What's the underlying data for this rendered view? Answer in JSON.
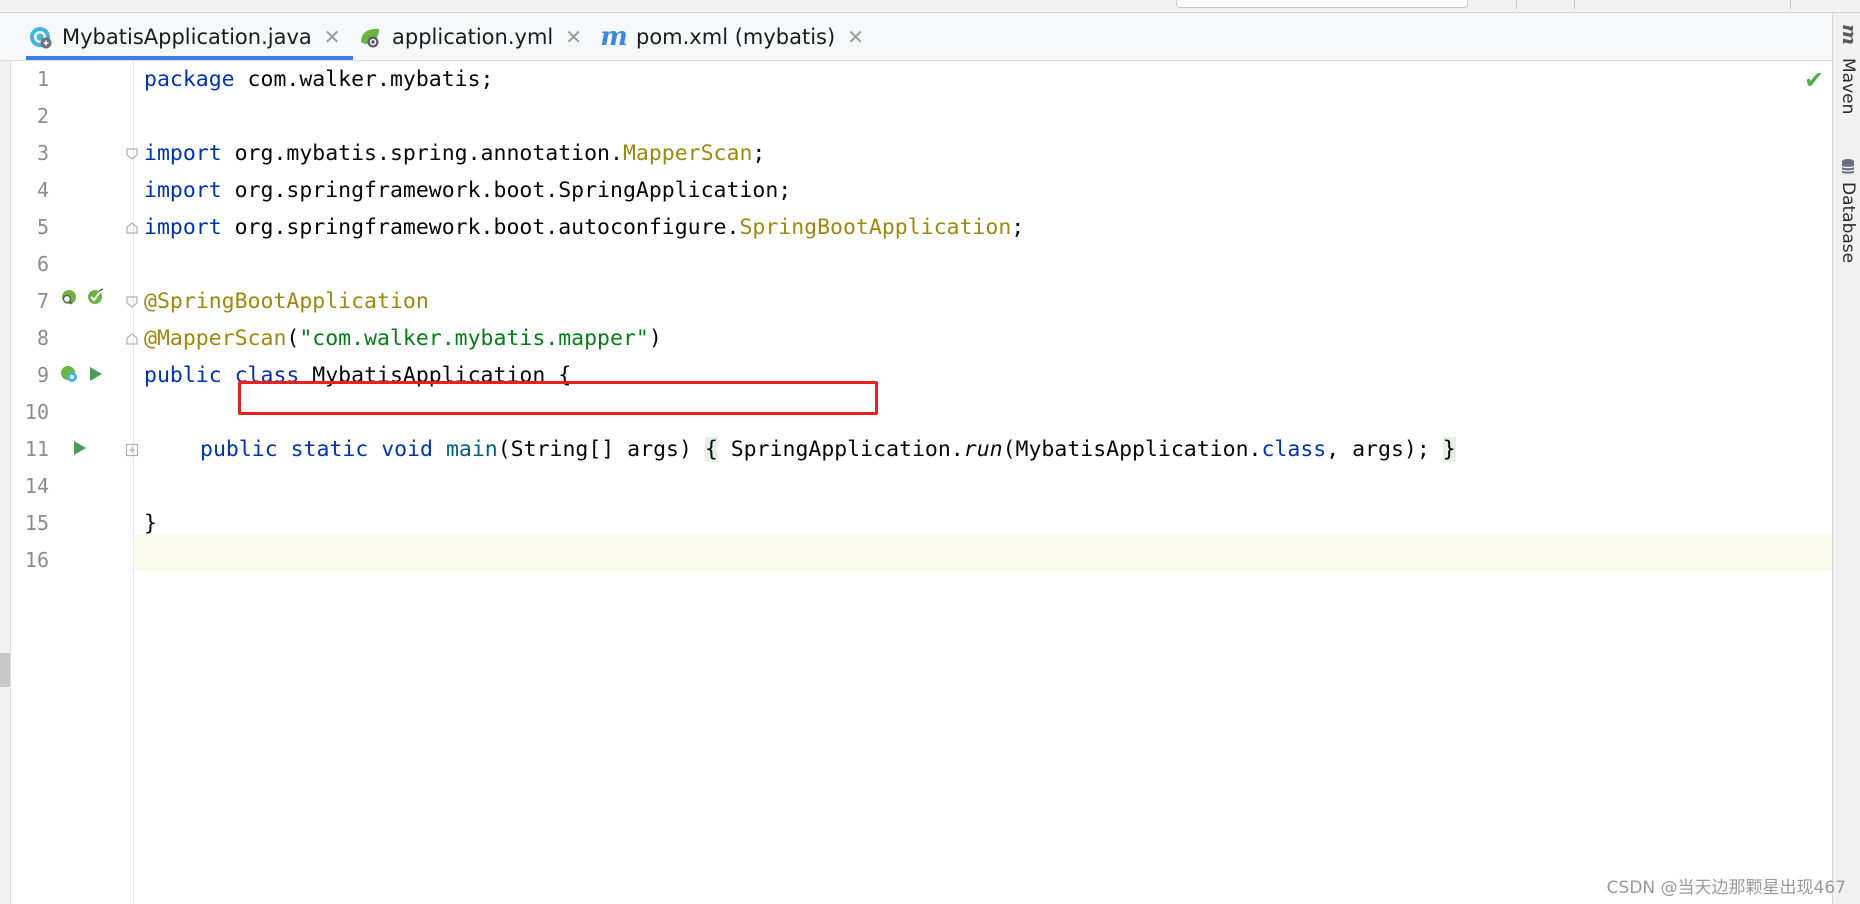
{
  "tabs": [
    {
      "label": "MybatisApplication.java",
      "icon": "java-class-icon",
      "active": true
    },
    {
      "label": "application.yml",
      "icon": "spring-leaf-icon",
      "active": false
    },
    {
      "label": "pom.xml (mybatis)",
      "icon": "maven-icon",
      "active": false
    }
  ],
  "close_glyph": "✕",
  "line_numbers": [
    "1",
    "2",
    "3",
    "4",
    "5",
    "6",
    "7",
    "8",
    "9",
    "10",
    "11",
    "14",
    "15",
    "16"
  ],
  "code": {
    "l1": {
      "kw": "package",
      "rest": " com.walker.mybatis;"
    },
    "l3": {
      "kw": "import",
      "pkg": " org.mybatis.spring.annotation.",
      "cls": "MapperScan",
      "end": ";"
    },
    "l4": {
      "kw": "import",
      "rest": " org.springframework.boot.SpringApplication;"
    },
    "l5": {
      "kw": "import",
      "pkg": " org.springframework.boot.autoconfigure.",
      "cls": "SpringBootApplication",
      "end": ";"
    },
    "l7": {
      "anno": "@SpringBootApplication"
    },
    "l8": {
      "anno": "@MapperScan",
      "open": "(",
      "str": "\"com.walker.mybatis.mapper\"",
      "close": ")"
    },
    "l9": {
      "kw": "public class",
      "rest": " MybatisApplication {"
    },
    "l11": {
      "kw": "public static void",
      "sp": " ",
      "fn": "main",
      "params": "(String[] args) ",
      "lbrace": "{",
      "body1": " SpringApplication.",
      "run": "run",
      "body2": "(MybatisApplication.",
      "cls": "class",
      "body3": ", args); ",
      "rbrace": "}"
    },
    "l15": {
      "rest": "}"
    }
  },
  "status": {
    "check": "✔"
  },
  "right_tools": [
    "Maven",
    "Database"
  ],
  "right_tool_glyph": "m",
  "watermark": "CSDN @当天边那颗星出现467",
  "colors": {
    "keyword": "#0033b3",
    "annotation": "#9e880d",
    "string": "#067d17",
    "highlight_box": "#e8211a",
    "accent": "#3d7ee6"
  }
}
